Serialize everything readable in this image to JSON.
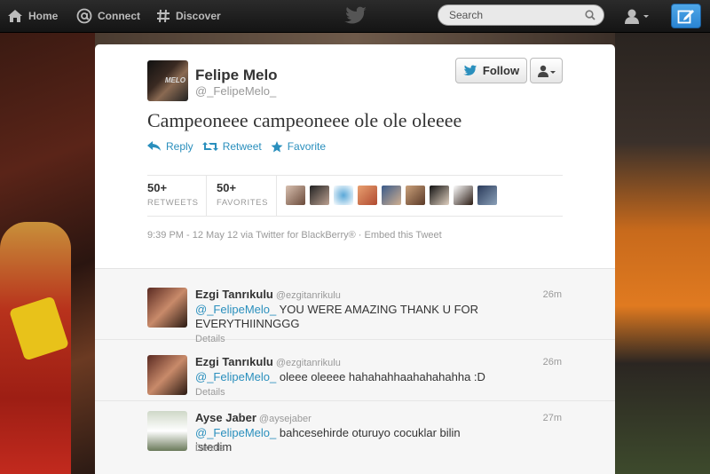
{
  "topbar": {
    "home_label": "Home",
    "connect_label": "Connect",
    "discover_label": "Discover",
    "search_placeholder": "Search",
    "logo_icon": "twitter-bird-icon",
    "compose_icon": "compose-tweet-icon"
  },
  "tweet": {
    "fullname": "Felipe Melo",
    "username": "@_FelipeMelo_",
    "avatar_text": "MELO",
    "follow_label": "Follow",
    "text": "Campeoneee campeoneee ole ole oleeee",
    "actions": {
      "reply": "Reply",
      "retweet": "Retweet",
      "favorite": "Favorite"
    },
    "stats": {
      "retweets_count": "50+",
      "retweets_label": "RETWEETS",
      "favorites_count": "50+",
      "favorites_label": "FAVORITES"
    },
    "meta": "9:39 PM - 12 May 12 via Twitter for BlackBerry® · Embed this Tweet"
  },
  "replies": [
    {
      "name": "Ezgi Tanrıkulu",
      "handle": "@ezgitanrikulu",
      "time": "26m",
      "mention": "@_FelipeMelo_",
      "text": " YOU WERE AMAZING THANK U FOR EVERYTHIINNGGG",
      "details": "Details"
    },
    {
      "name": "Ezgi Tanrıkulu",
      "handle": "@ezgitanrikulu",
      "time": "26m",
      "mention": "@_FelipeMelo_",
      "text": " oleee oleeee hahahahhaahahahahha :D",
      "details": "Details"
    },
    {
      "name": "Ayse Jaber",
      "handle": "@aysejaber",
      "time": "27m",
      "mention": "@_FelipeMelo_",
      "text": " bahcesehirde oturuyo cocuklar bilin istedim",
      "details": "Details"
    }
  ],
  "colors": {
    "link": "#2a8fbd",
    "compose_button": "#2a84d2"
  }
}
